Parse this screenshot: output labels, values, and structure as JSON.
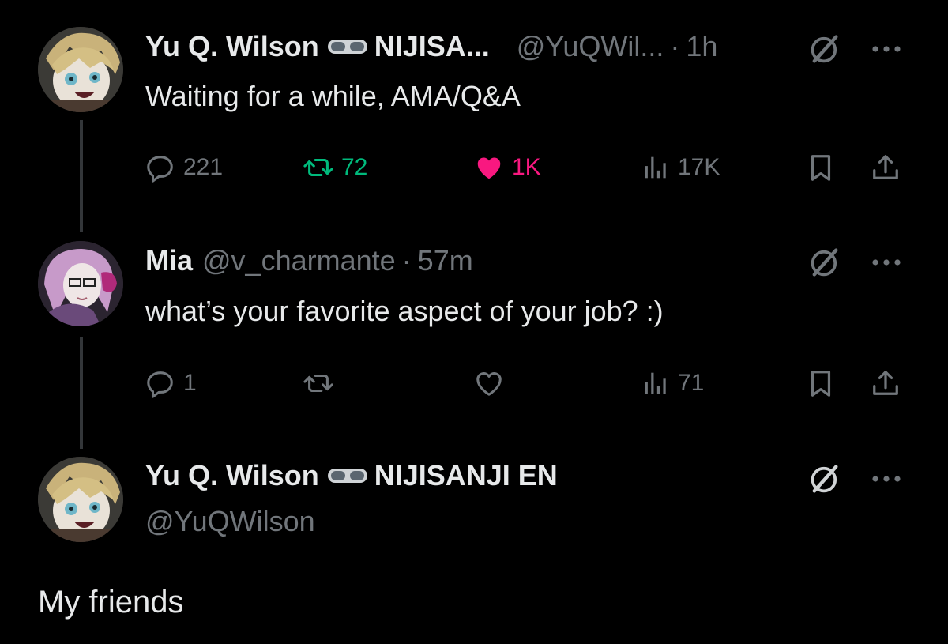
{
  "tweets": [
    {
      "author": "Yu Q. Wilson",
      "affiliation": "NIJISA...",
      "handle": "@YuQWil...",
      "sep": "·",
      "time": "1h",
      "text": "Waiting for a while, AMA/Q&A",
      "replies": "221",
      "retweets": "72",
      "likes": "1K",
      "views": "17K"
    },
    {
      "author": "Mia",
      "handle": "@v_charmante",
      "sep": "·",
      "time": "57m",
      "text": "what’s your favorite aspect of your job? :)",
      "replies": "1",
      "views": "71"
    },
    {
      "author": "Yu Q. Wilson",
      "affiliation": "NIJISANJI EN",
      "handle": "@YuQWilson",
      "text": "My friends"
    }
  ],
  "colors": {
    "background": "#000000",
    "text": "#e7e9ea",
    "muted": "#71767b",
    "retweet": "#00ba7c",
    "like": "#f91880"
  },
  "icons": [
    "goggles-icon",
    "grok-icon",
    "more-icon",
    "reply-icon",
    "retweet-icon",
    "heart-icon",
    "views-icon",
    "bookmark-icon",
    "share-icon"
  ]
}
